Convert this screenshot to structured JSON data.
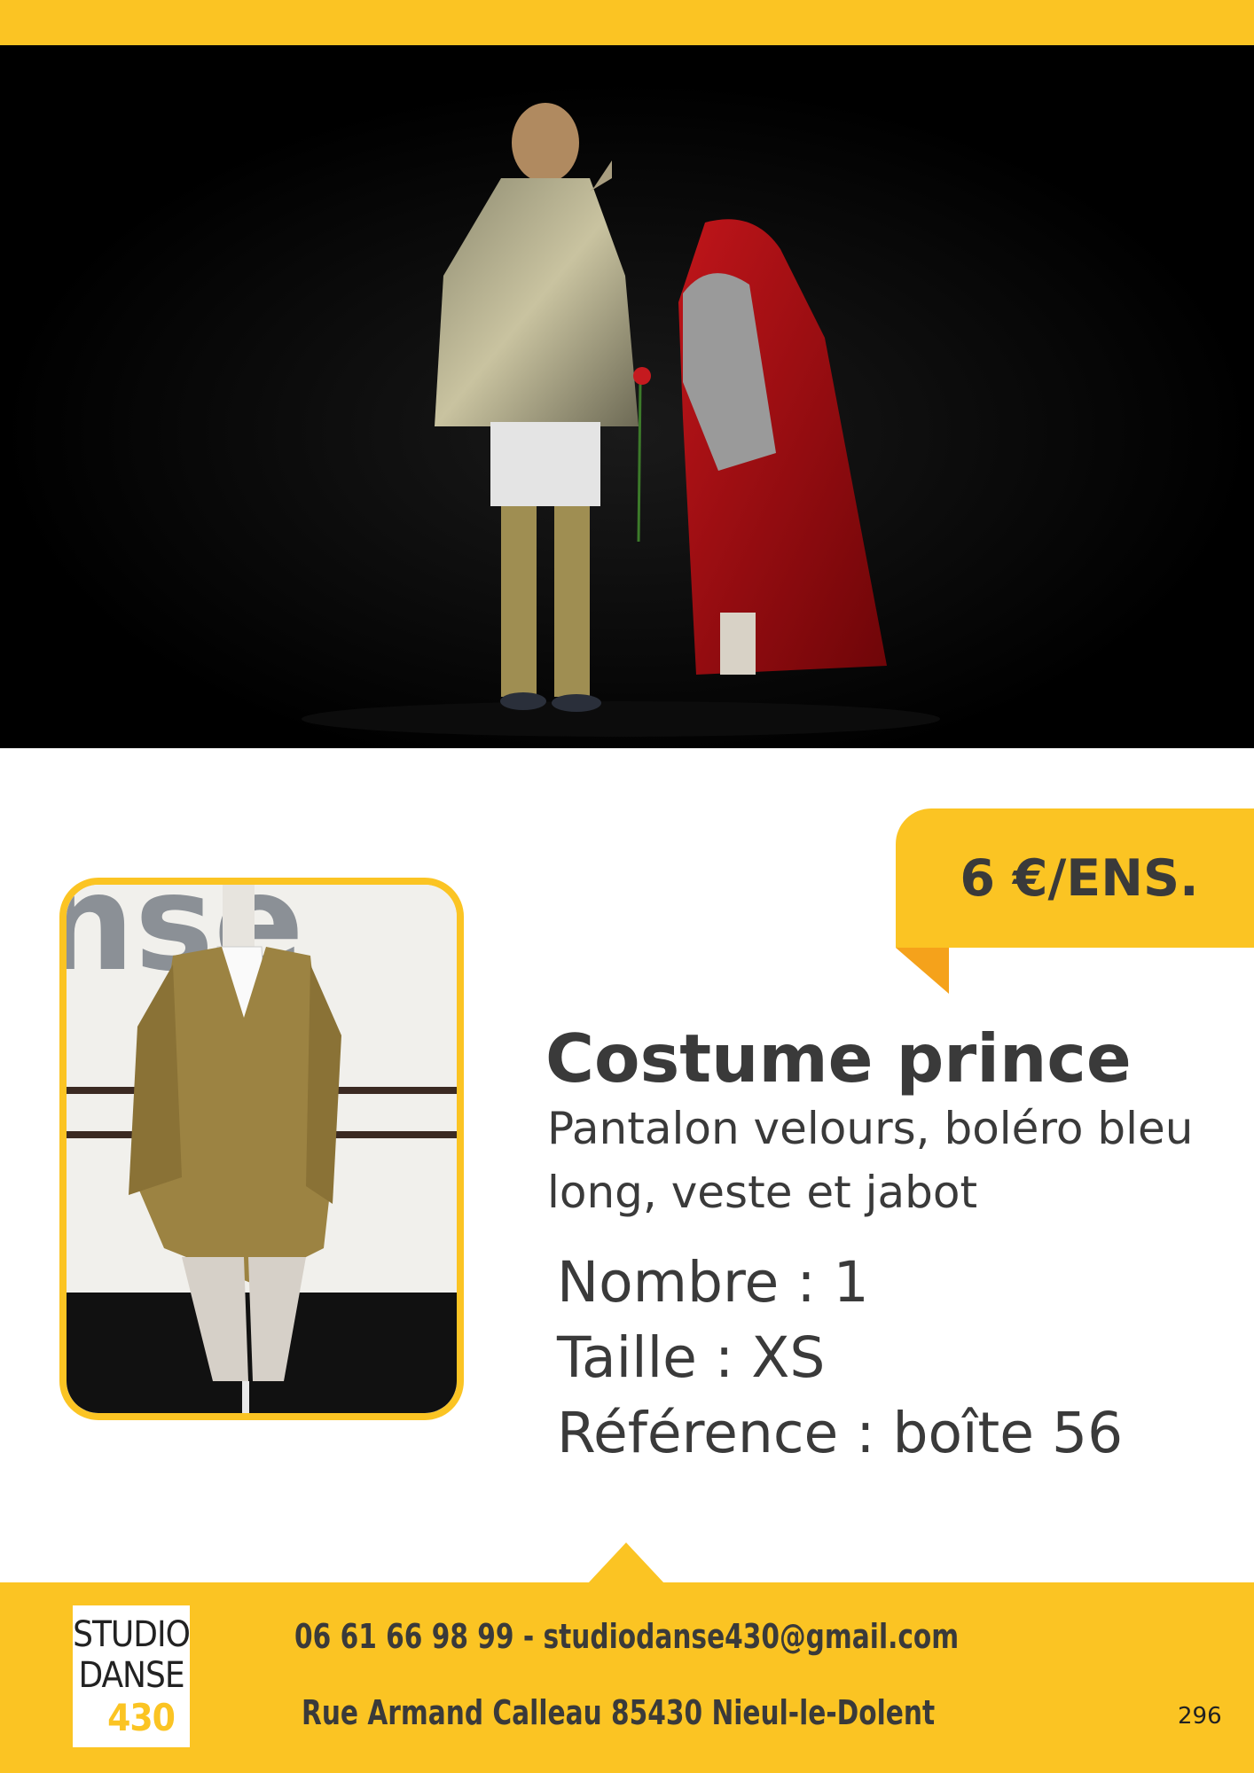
{
  "price": "6 €/ENS.",
  "costume": {
    "title": "Costume prince",
    "description": "Pantalon velours, boléro bleu long, veste et jabot",
    "count_line": "Nombre : 1",
    "size_line": "Taille : XS",
    "reference_line": "Référence : boîte 56"
  },
  "footer": {
    "logo_line1": "STUDIO",
    "logo_line2": "DANSE",
    "logo_line3": "430",
    "contact": "06 61 66 98 99 - studiodanse430@gmail.com",
    "address": "Rue Armand Calleau 85430 Nieul-le-Dolent",
    "page_number": "296"
  },
  "colors": {
    "accent": "#fbc423",
    "accent_dark": "#f5a21b",
    "text": "#3a3a3a"
  }
}
